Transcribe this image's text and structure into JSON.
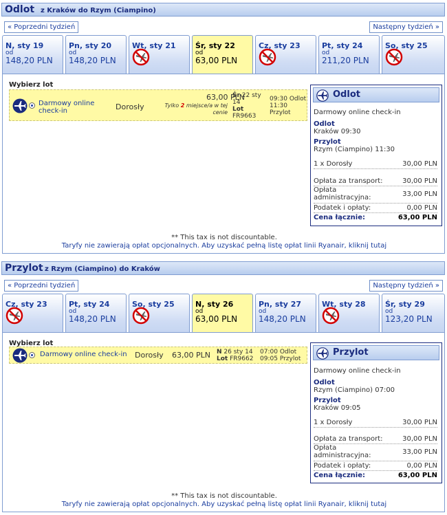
{
  "outbound": {
    "title": "Odlot",
    "route": "z Kraków do Rzym (Ciampino)",
    "prev_week": "« Poprzedni tydzień",
    "next_week": "Następny tydzień »",
    "days": [
      {
        "label": "N, sty 19",
        "od": "od",
        "price": "148,20 PLN",
        "available": true,
        "selected": false
      },
      {
        "label": "Pn, sty 20",
        "od": "od",
        "price": "148,20 PLN",
        "available": true,
        "selected": false
      },
      {
        "label": "Wt, sty 21",
        "available": false,
        "selected": false
      },
      {
        "label": "Śr, sty 22",
        "od": "od",
        "price": "63,00 PLN",
        "available": true,
        "selected": true
      },
      {
        "label": "Cz, sty 23",
        "available": false,
        "selected": false
      },
      {
        "label": "Pt, sty 24",
        "od": "od",
        "price": "211,20 PLN",
        "available": true,
        "selected": false
      },
      {
        "label": "So, sty 25",
        "available": false,
        "selected": false
      }
    ],
    "choose_label": "Wybierz lot",
    "flight": {
      "checkin": "Darmowy online check-in",
      "passenger": "Dorosły",
      "price": "63,00 PLN",
      "seats_pre": "Tylko",
      "seats_count": "2",
      "seats_post": "miejsce/a w tej cenie",
      "day": "Śr",
      "date": "22 sty 14",
      "flight_label": "Lot",
      "flight_no": "FR9663",
      "dep_time": "09:30",
      "dep_label": "Odlot",
      "arr_time": "11:30",
      "arr_label": "Przylot"
    },
    "summary": {
      "title": "Odlot",
      "checkin": "Darmowy online check-in",
      "dep_label": "Odlot",
      "dep_value": "Kraków 09:30",
      "arr_label": "Przylot",
      "arr_value": "Rzym (Ciampino) 11:30",
      "pax_label": "1 x Dorosły",
      "pax_value": "30,00 PLN",
      "transport_label": "Opłata za transport:",
      "transport_value": "30,00 PLN",
      "admin_label_1": "Opłata",
      "admin_label_2": "administracyjna:",
      "admin_value": "33,00 PLN",
      "tax_label": "Podatek i opłaty:",
      "tax_value": "0,00 PLN",
      "total_label": "Cena łącznie:",
      "total_value": "63,00 PLN"
    },
    "note1": "** This tax is not discountable.",
    "note2": "Taryfy nie zawierają opłat opcjonalnych. Aby uzyskać pełną listę opłat linii Ryanair, kliknij tutaj"
  },
  "inbound": {
    "title": "Przylot",
    "route": "z Rzym (Ciampino) do Kraków",
    "prev_week": "« Poprzedni tydzień",
    "next_week": "Następny tydzień »",
    "days": [
      {
        "label": "Cz, sty 23",
        "available": false,
        "selected": false
      },
      {
        "label": "Pt, sty 24",
        "od": "od",
        "price": "148,20 PLN",
        "available": true,
        "selected": false
      },
      {
        "label": "So, sty 25",
        "available": false,
        "selected": false
      },
      {
        "label": "N, sty 26",
        "od": "od",
        "price": "63,00 PLN",
        "available": true,
        "selected": true
      },
      {
        "label": "Pn, sty 27",
        "od": "od",
        "price": "148,20 PLN",
        "available": true,
        "selected": false
      },
      {
        "label": "Wt, sty 28",
        "available": false,
        "selected": false
      },
      {
        "label": "Śr, sty 29",
        "od": "od",
        "price": "123,20 PLN",
        "available": true,
        "selected": false
      }
    ],
    "choose_label": "Wybierz lot",
    "flight": {
      "checkin": "Darmowy online check-in",
      "passenger": "Dorosły",
      "price": "63,00 PLN",
      "day": "N",
      "date": "26 sty 14",
      "flight_label": "Lot",
      "flight_no": "FR9662",
      "dep_time": "07:00",
      "dep_label": "Odlot",
      "arr_time": "09:05",
      "arr_label": "Przylot"
    },
    "summary": {
      "title": "Przylot",
      "checkin": "Darmowy online check-in",
      "dep_label": "Odlot",
      "dep_value": "Rzym (Ciampino) 07:00",
      "arr_label": "Przylot",
      "arr_value": "Kraków 09:05",
      "pax_label": "1 x Dorosły",
      "pax_value": "30,00 PLN",
      "transport_label": "Opłata za transport:",
      "transport_value": "30,00 PLN",
      "admin_label_1": "Opłata",
      "admin_label_2": "administracyjna:",
      "admin_value": "33,00 PLN",
      "tax_label": "Podatek i opłaty:",
      "tax_value": "0,00 PLN",
      "total_label": "Cena łącznie:",
      "total_value": "63,00 PLN"
    },
    "note1": "** This tax is not discountable.",
    "note2": "Taryfy nie zawierają opłat opcjonalnych. Aby uzyskać pełną listę opłat linii Ryanair, kliknij tutaj"
  },
  "colors": {
    "accent": "#1a3d9e",
    "header_text": "#1a2b7e",
    "selected_bg": "#fffaa5",
    "no_flight": "#d20000"
  },
  "icons": {
    "plane": "plane-icon",
    "no_flight": "no-flight-icon",
    "radio": "radio-selected-icon"
  }
}
